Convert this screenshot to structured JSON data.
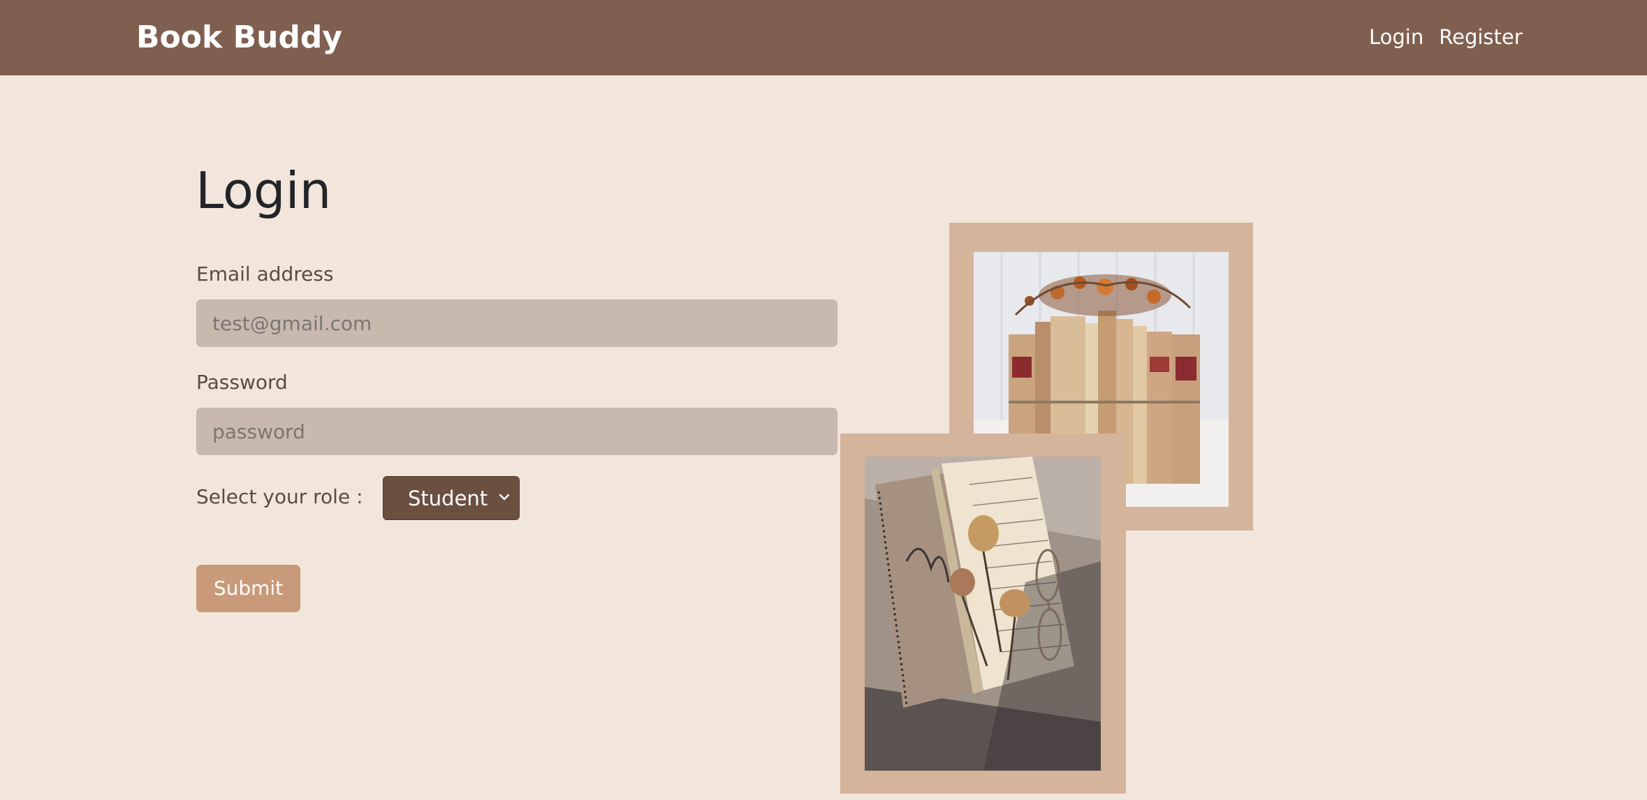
{
  "navbar": {
    "brand": "Book Buddy",
    "links": [
      {
        "label": "Login"
      },
      {
        "label": "Register"
      }
    ],
    "background_color": "#7f5f50"
  },
  "form": {
    "title": "Login",
    "email": {
      "label": "Email address",
      "placeholder": "test@gmail.com",
      "value": ""
    },
    "password": {
      "label": "Password",
      "placeholder": "password",
      "value": ""
    },
    "role": {
      "label": "Select your role :",
      "selected": "Student",
      "icon": "chevron-down-icon"
    },
    "submit_label": "Submit"
  },
  "images": [
    {
      "name": "photo-books-with-dried-flowers"
    },
    {
      "name": "photo-open-book-with-roses-and-glasses"
    }
  ],
  "colors": {
    "page_background": "#f2e6dc",
    "input_background": "#c8b9af",
    "select_background": "#6b4f3f",
    "submit_background": "#c99a79",
    "frame_color": "#d5b49c"
  }
}
